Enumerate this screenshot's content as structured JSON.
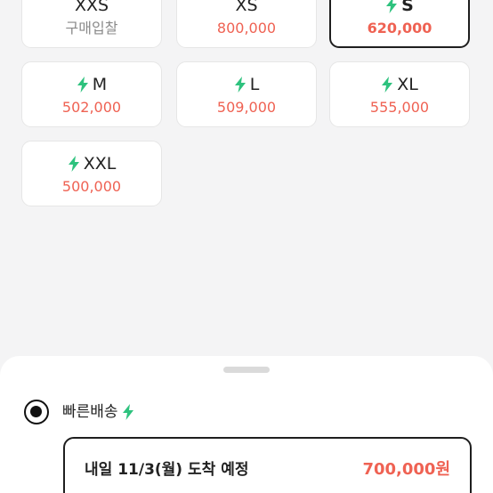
{
  "sizes": [
    {
      "label": "XXS",
      "price": "구매입찰",
      "fast": false,
      "selected": false,
      "muted": true
    },
    {
      "label": "XS",
      "price": "800,000",
      "fast": false,
      "selected": false,
      "muted": false
    },
    {
      "label": "S",
      "price": "620,000",
      "fast": true,
      "selected": true,
      "muted": false
    },
    {
      "label": "M",
      "price": "502,000",
      "fast": true,
      "selected": false,
      "muted": false
    },
    {
      "label": "L",
      "price": "509,000",
      "fast": true,
      "selected": false,
      "muted": false
    },
    {
      "label": "XL",
      "price": "555,000",
      "fast": true,
      "selected": false,
      "muted": false
    },
    {
      "label": "XXL",
      "price": "500,000",
      "fast": true,
      "selected": false,
      "muted": false
    }
  ],
  "shipping": {
    "option_label": "빠른배송",
    "option_icon": "lightning-icon",
    "selected": true,
    "delivery_text": "내일 11/3(월) 도착 예정",
    "delivery_price": "700,000원"
  },
  "colors": {
    "price": "#ef6253",
    "fast_icon": "#2ec27e",
    "selected_border": "#1e1e1e"
  }
}
